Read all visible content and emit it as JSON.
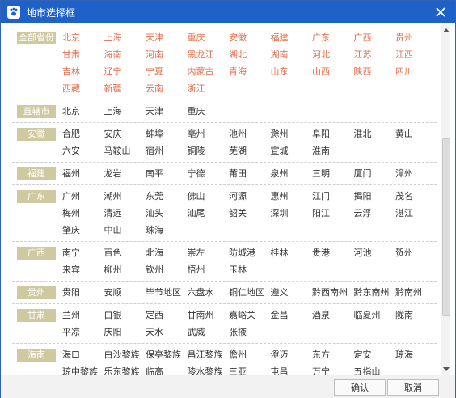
{
  "window": {
    "title": "地市选择框"
  },
  "colors": {
    "title_bar": "#1e62c9",
    "tag_bg": "#cfc9a0",
    "hot_city": "#e36c4a"
  },
  "groups": [
    {
      "tag": "全部省份",
      "highlight": true,
      "cities": [
        "北京",
        "上海",
        "天津",
        "重庆",
        "安徽",
        "福建",
        "广东",
        "广西",
        "贵州",
        "甘肃",
        "海南",
        "河南",
        "黑龙江",
        "湖北",
        "湖南",
        "河北",
        "江苏",
        "江西",
        "吉林",
        "辽宁",
        "宁夏",
        "内蒙古",
        "青海",
        "山东",
        "山西",
        "陕西",
        "四川",
        "西藏",
        "新疆",
        "云南",
        "浙江"
      ]
    },
    {
      "tag": "直辖市",
      "cities": [
        "北京",
        "上海",
        "天津",
        "重庆"
      ]
    },
    {
      "tag": "安徽",
      "cities": [
        "合肥",
        "安庆",
        "蚌埠",
        "亳州",
        "池州",
        "滁州",
        "阜阳",
        "淮北",
        "黄山",
        "六安",
        "马鞍山",
        "宿州",
        "铜陵",
        "芜湖",
        "宣城",
        "淮南"
      ]
    },
    {
      "tag": "福建",
      "cities": [
        "福州",
        "龙岩",
        "南平",
        "宁德",
        "莆田",
        "泉州",
        "三明",
        "厦门",
        "漳州"
      ]
    },
    {
      "tag": "广东",
      "cities": [
        "广州",
        "潮州",
        "东莞",
        "佛山",
        "河源",
        "惠州",
        "江门",
        "揭阳",
        "茂名",
        "梅州",
        "清远",
        "汕头",
        "汕尾",
        "韶关",
        "深圳",
        "阳江",
        "云浮",
        "湛江",
        "肇庆",
        "中山",
        "珠海"
      ]
    },
    {
      "tag": "广西",
      "cities": [
        "南宁",
        "百色",
        "北海",
        "崇左",
        "防城港",
        "桂林",
        "贵港",
        "河池",
        "贺州",
        "来宾",
        "柳州",
        "钦州",
        "梧州",
        "玉林"
      ]
    },
    {
      "tag": "贵州",
      "cities": [
        "贵阳",
        "安顺",
        "毕节地区",
        "六盘水",
        "铜仁地区",
        "遵义",
        "黔西南州",
        "黔东南州",
        "黔南州"
      ]
    },
    {
      "tag": "甘肃",
      "cities": [
        "兰州",
        "白银",
        "定西",
        "甘南州",
        "嘉峪关",
        "金昌",
        "酒泉",
        "临夏州",
        "陇南",
        "平凉",
        "庆阳",
        "天水",
        "武威",
        "张掖"
      ]
    },
    {
      "tag": "海南",
      "cities": [
        "海口",
        "白沙黎族",
        "保亭黎族",
        "昌江黎族",
        "儋州",
        "澄迈",
        "东方",
        "定安",
        "琼海",
        "琼中黎族",
        "乐东黎族",
        "临高",
        "陵水黎族",
        "三亚",
        "屯昌",
        "万宁",
        "五指山"
      ]
    }
  ],
  "footer": {
    "ok_label": "确认",
    "cancel_label": "取消"
  }
}
